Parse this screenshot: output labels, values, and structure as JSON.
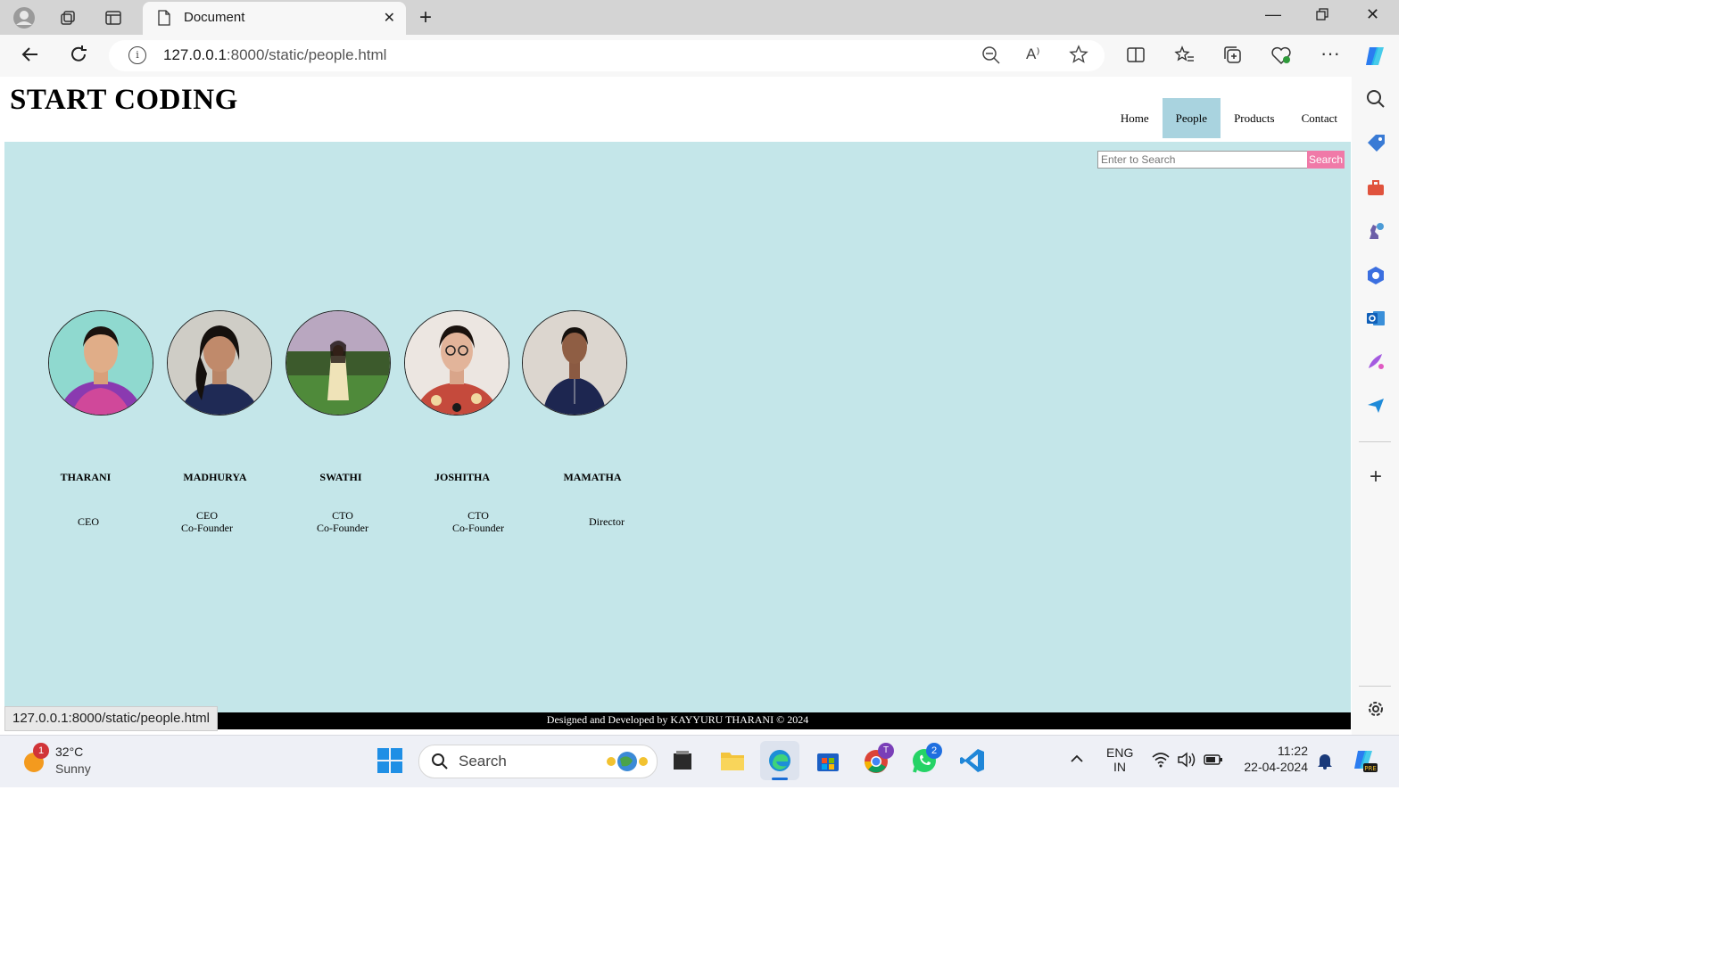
{
  "browser": {
    "tab_title": "Document",
    "url_host": "127.0.0.1",
    "url_path": ":8000/static/people.html",
    "status_url": "127.0.0.1:8000/static/people.html"
  },
  "page": {
    "brand": "START CODING",
    "nav": [
      "Home",
      "People",
      "Products",
      "Contact"
    ],
    "active_nav": "People",
    "search_placeholder": "Enter to Search",
    "search_button": "Search",
    "people": [
      {
        "name": "THARANI",
        "role1": "CEO",
        "role2": ""
      },
      {
        "name": "MADHURYA",
        "role1": "CEO",
        "role2": "Co-Founder"
      },
      {
        "name": "SWATHI",
        "role1": "CTO",
        "role2": "Co-Founder"
      },
      {
        "name": "JOSHITHA",
        "role1": "CTO",
        "role2": "Co-Founder"
      },
      {
        "name": "MAMATHA",
        "role1": "Director",
        "role2": ""
      }
    ],
    "footer": "Designed and Developed by KAYYURU THARANI © 2024",
    "colors": {
      "page_bg": "#c4e6e9",
      "active_nav": "#a9d3df",
      "search_button": "#f07aa8"
    }
  },
  "taskbar": {
    "weather_temp": "32°C",
    "weather_desc": "Sunny",
    "weather_badge": "1",
    "search_label": "Search",
    "lang1": "ENG",
    "lang2": "IN",
    "time": "11:22",
    "date": "22-04-2024",
    "chrome_badge": "T",
    "whatsapp_badge": "2"
  }
}
